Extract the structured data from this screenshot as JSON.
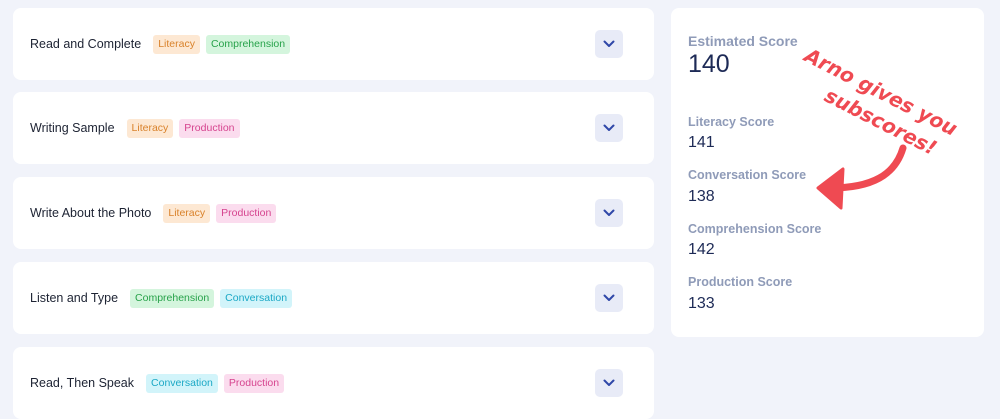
{
  "cards": [
    {
      "title": "Read and Complete",
      "tags": [
        {
          "label": "Literacy",
          "kind": "literacy"
        },
        {
          "label": "Comprehension",
          "kind": "comprehension"
        }
      ]
    },
    {
      "title": "Writing Sample",
      "tags": [
        {
          "label": "Literacy",
          "kind": "literacy"
        },
        {
          "label": "Production",
          "kind": "production"
        }
      ]
    },
    {
      "title": "Write About the Photo",
      "tags": [
        {
          "label": "Literacy",
          "kind": "literacy"
        },
        {
          "label": "Production",
          "kind": "production"
        }
      ]
    },
    {
      "title": "Listen and Type",
      "tags": [
        {
          "label": "Comprehension",
          "kind": "comprehension"
        },
        {
          "label": "Conversation",
          "kind": "conversation"
        }
      ]
    },
    {
      "title": "Read, Then Speak",
      "tags": [
        {
          "label": "Conversation",
          "kind": "conversation"
        },
        {
          "label": "Production",
          "kind": "production"
        }
      ]
    }
  ],
  "scores": {
    "estimated": {
      "label": "Estimated Score",
      "value": "140"
    },
    "literacy": {
      "label": "Literacy Score",
      "value": "141"
    },
    "conversation": {
      "label": "Conversation Score",
      "value": "138"
    },
    "comprehension": {
      "label": "Comprehension Score",
      "value": "142"
    },
    "production": {
      "label": "Production Score",
      "value": "133"
    }
  },
  "annotation": {
    "line1": "Arno gives you",
    "line2": "subscores!",
    "color": "#ef4a52"
  },
  "icons": {
    "expand": "chevron-down-icon"
  }
}
